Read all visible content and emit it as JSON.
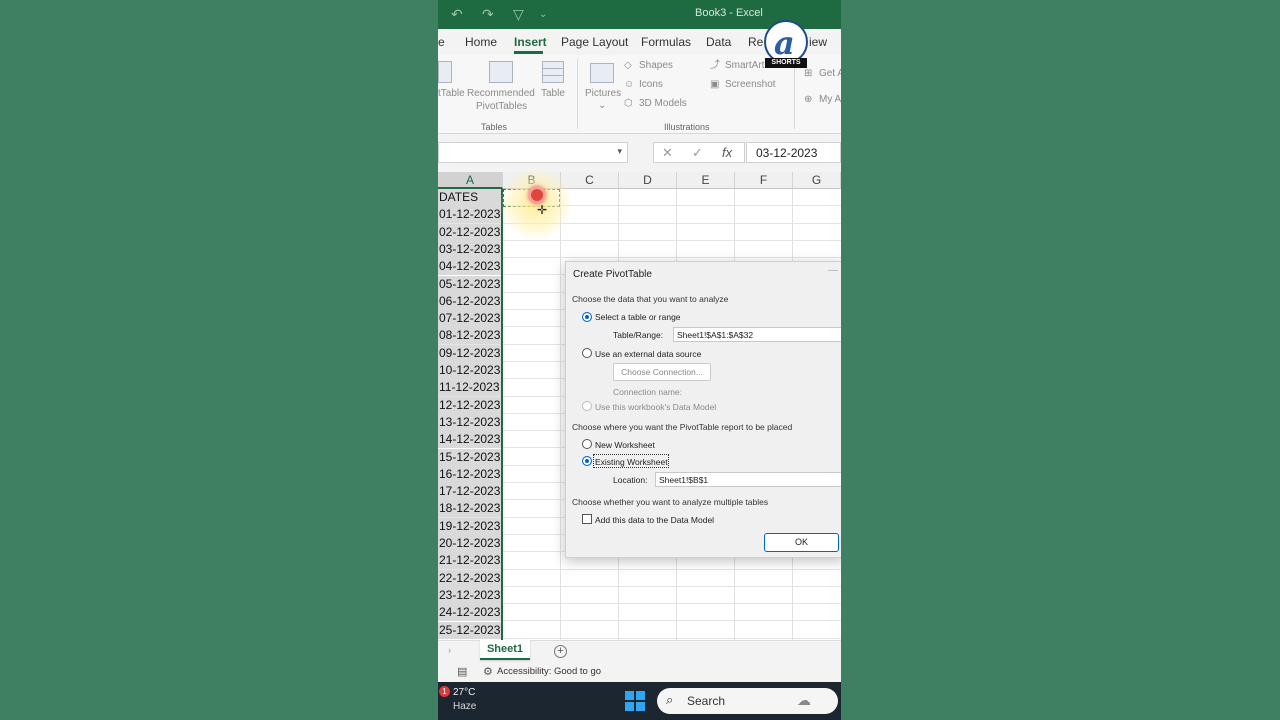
{
  "app": {
    "title": "Book3 - Excel"
  },
  "ribbon_tabs": [
    {
      "label": "e"
    },
    {
      "label": "Home"
    },
    {
      "label": "Insert",
      "active": true
    },
    {
      "label": "Page Layout"
    },
    {
      "label": "Formulas"
    },
    {
      "label": "Data"
    },
    {
      "label": "Re"
    },
    {
      "label": "iew"
    }
  ],
  "ribbon": {
    "pivottable_label": "tTable",
    "recommended_label_1": "Recommended",
    "recommended_label_2": "PivotTables",
    "table_label": "Table",
    "tables_group": "Tables",
    "pictures_label": "Pictures",
    "shapes_label": "Shapes",
    "icons_label": "Icons",
    "models_label": "3D Models",
    "smartart_label": "SmartArt",
    "screenshot_label": "Screenshot",
    "illustrations_group": "Illustrations",
    "getaddins_label": "Get A",
    "myaddins_label": "My A"
  },
  "formula_bar": {
    "value": "03-12-2023",
    "fx_label": "fx"
  },
  "columns": [
    "A",
    "B",
    "C",
    "D",
    "E",
    "F",
    "G"
  ],
  "column_a": [
    "DATES",
    "01-12-2023",
    "02-12-2023",
    "03-12-2023",
    "04-12-2023",
    "05-12-2023",
    "06-12-2023",
    "07-12-2023",
    "08-12-2023",
    "09-12-2023",
    "10-12-2023",
    "11-12-2023",
    "12-12-2023",
    "13-12-2023",
    "14-12-2023",
    "15-12-2023",
    "16-12-2023",
    "17-12-2023",
    "18-12-2023",
    "19-12-2023",
    "20-12-2023",
    "21-12-2023",
    "22-12-2023",
    "23-12-2023",
    "24-12-2023",
    "25-12-2023"
  ],
  "dialog": {
    "title": "Create PivotTable",
    "section_data": "Choose the data that you want to analyze",
    "opt_table_range": "Select a table or range",
    "table_range_label": "Table/Range:",
    "table_range_value": "Sheet1!$A$1:$A$32",
    "opt_external": "Use an external data source",
    "choose_connection": "Choose Connection...",
    "connection_name": "Connection name:",
    "opt_data_model": "Use this workbook's Data Model",
    "section_place": "Choose where you want the PivotTable report to be placed",
    "opt_new_ws": "New Worksheet",
    "opt_existing_ws": "Existing Worksheet",
    "location_label": "Location:",
    "location_value": "Sheet1!$B$1",
    "section_multiple": "Choose whether you want to analyze multiple tables",
    "add_data_model": "Add this data to the Data Model",
    "ok": "OK"
  },
  "sheets": {
    "active": "Sheet1",
    "add": "+"
  },
  "status": {
    "accessibility": "Accessibility: Good to go"
  },
  "taskbar": {
    "badge": "1",
    "temp": "27°C",
    "weather": "Haze",
    "search": "Search"
  },
  "logo": {
    "letter": "a",
    "tag": "SHORTS"
  },
  "colors": {
    "excel_green": "#1e6b41",
    "background_green": "#3f8063",
    "dialog_accent": "#0067c0"
  }
}
